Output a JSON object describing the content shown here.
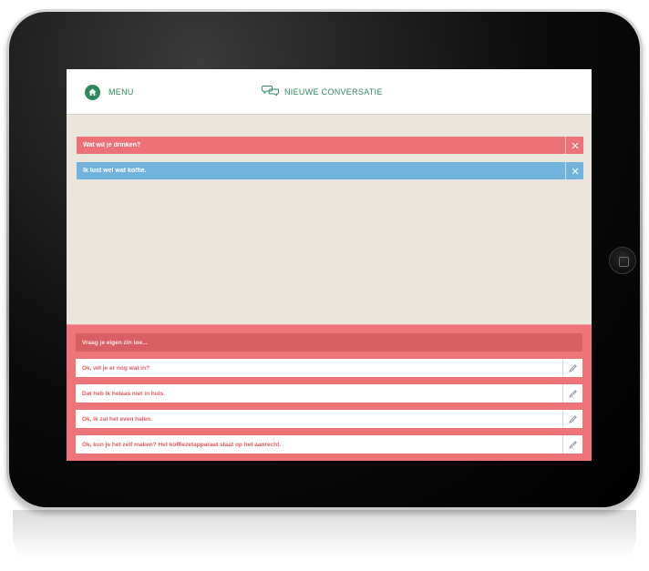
{
  "header": {
    "menu_label": "MENU",
    "menu_icon": "home-icon",
    "new_conversation_label": "NIEUWE CONVERSATIE",
    "new_conversation_icon": "speech-bubbles-icon"
  },
  "conversation": {
    "messages": [
      {
        "text": "Wat wil je drinken?",
        "color": "#ec7277",
        "close_icon": "close-icon"
      },
      {
        "text": "Ik lust wel wat koffie.",
        "color": "#71b3dc",
        "close_icon": "close-icon"
      }
    ]
  },
  "answer_panel": {
    "prompt_placeholder": "Vraag je eigen zin toe...",
    "options": [
      {
        "text": "Ok, wil je er nog wat in?",
        "icon": "pencil-icon"
      },
      {
        "text": "Dat heb ik helaas niet in huis.",
        "icon": "pencil-icon"
      },
      {
        "text": "Ok, ik zal het even halen.",
        "icon": "pencil-icon"
      },
      {
        "text": "Ok, kun je het zelf maken? Het koffiezetapparaat staat op het aanrecht.",
        "icon": "pencil-icon"
      }
    ]
  },
  "colors": {
    "accent_green": "#2e8a5c",
    "screen_bg": "#ebe6db",
    "panel_red": "#ee7479",
    "bubble_blue": "#71b3dc"
  }
}
